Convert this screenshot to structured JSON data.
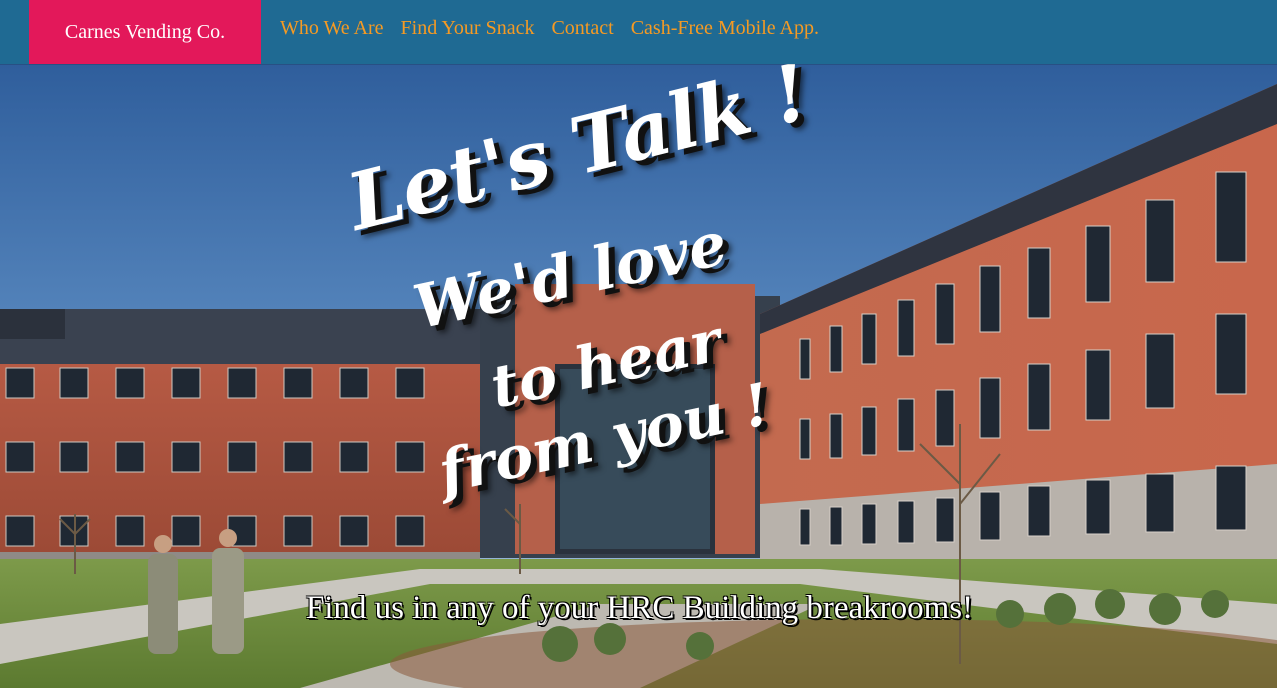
{
  "brand": {
    "name": "Carnes Vending Co."
  },
  "nav": {
    "items": [
      {
        "label": "Who We Are"
      },
      {
        "label": "Find Your Snack"
      },
      {
        "label": "Contact"
      },
      {
        "label": "Cash-Free Mobile App."
      }
    ]
  },
  "hero": {
    "headline": {
      "line1": "Let's Talk !",
      "line2": "We'd  love",
      "line3": "to hear",
      "line4": "from you !"
    },
    "subtext": "Find us in any of your HRC Building breakrooms!"
  },
  "colors": {
    "topbar": "#1f6a93",
    "brand_bg": "#e3185a",
    "nav_link": "#f59a23",
    "headline": "#ffffff"
  }
}
